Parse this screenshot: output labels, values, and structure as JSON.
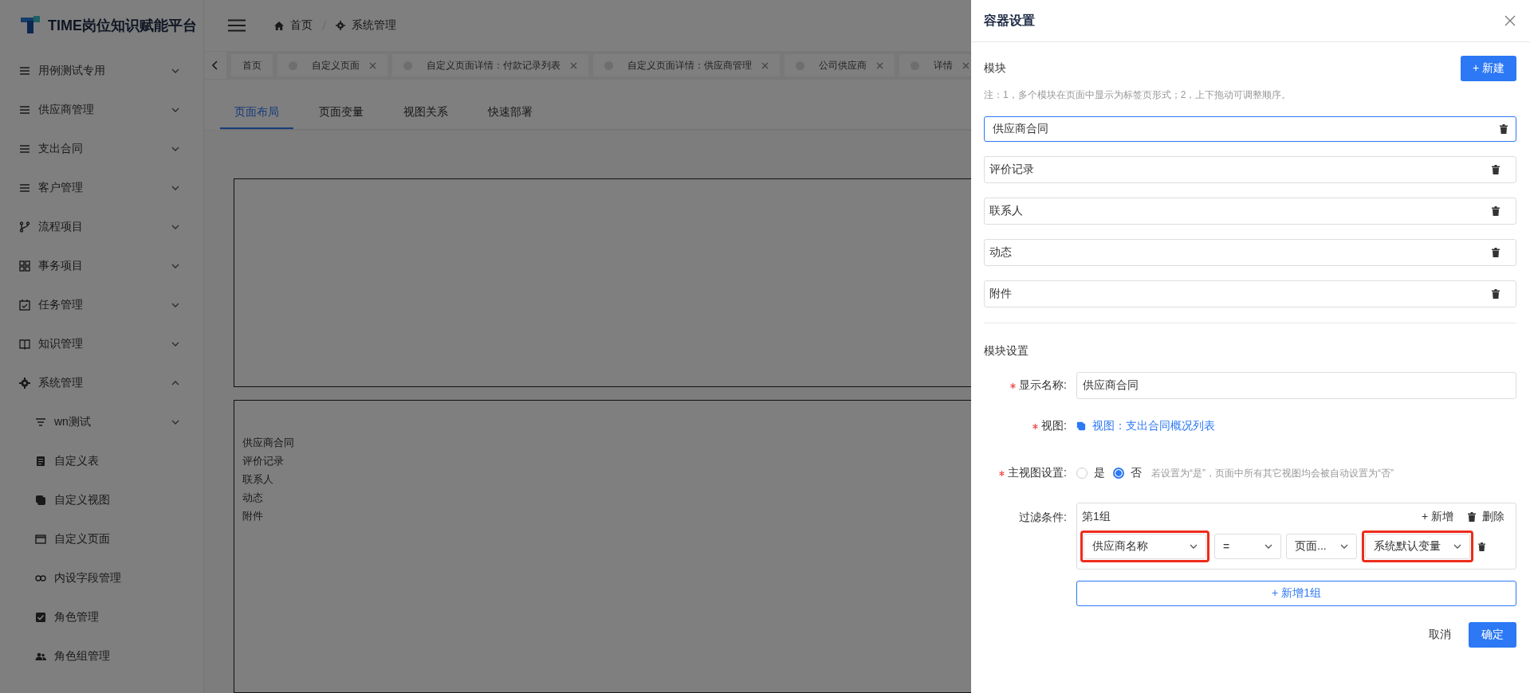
{
  "sidebar": {
    "logo": "TIME岗位知识赋能平台",
    "items": [
      {
        "label": "用例测试专用",
        "expanded": false
      },
      {
        "label": "供应商管理",
        "expanded": false
      },
      {
        "label": "支出合同",
        "expanded": false
      },
      {
        "label": "客户管理",
        "expanded": false
      },
      {
        "label": "流程项目",
        "expanded": false
      },
      {
        "label": "事务项目",
        "expanded": false
      },
      {
        "label": "任务管理",
        "expanded": false
      },
      {
        "label": "知识管理",
        "expanded": false
      },
      {
        "label": "系统管理",
        "expanded": true,
        "children": [
          {
            "label": "wn测试",
            "kind": "submenu",
            "expanded": false
          },
          {
            "label": "自定义表",
            "kind": "link"
          },
          {
            "label": "自定义视图",
            "kind": "link"
          },
          {
            "label": "自定义页面",
            "kind": "link"
          },
          {
            "label": "内设字段管理",
            "kind": "link"
          },
          {
            "label": "角色管理",
            "kind": "link"
          },
          {
            "label": "角色组管理",
            "kind": "link"
          }
        ]
      }
    ]
  },
  "breadcrumb": [
    "首页",
    "系统管理"
  ],
  "open_tabs": [
    {
      "label": "首页",
      "closable": false
    },
    {
      "label": "自定义页面",
      "closable": true
    },
    {
      "label": "自定义页面详情：付款记录列表",
      "closable": true
    },
    {
      "label": "自定义页面详情：供应商管理",
      "closable": true
    },
    {
      "label": "公司供应商",
      "closable": true
    },
    {
      "label": "详情",
      "closable": true
    }
  ],
  "page_tabs": [
    {
      "label": "页面布局",
      "selected": true
    },
    {
      "label": "页面变量",
      "selected": false
    },
    {
      "label": "视图关系",
      "selected": false
    },
    {
      "label": "快速部署",
      "selected": false
    }
  ],
  "canvas": {
    "container_items": [
      "供应商合同",
      "评价记录",
      "联系人",
      "动态",
      "附件"
    ]
  },
  "drawer": {
    "title": "容器设置",
    "modules_title": "模块",
    "new_button": "+ 新建",
    "note": "注：1，多个模块在页面中显示为标签页形式；2，上下拖动可调整顺序。",
    "modules": [
      {
        "name": "供应商合同",
        "selected": true
      },
      {
        "name": "评价记录",
        "selected": false
      },
      {
        "name": "联系人",
        "selected": false
      },
      {
        "name": "动态",
        "selected": false
      },
      {
        "name": "附件",
        "selected": false
      }
    ],
    "settings_title": "模块设置",
    "display_name": {
      "label": "显示名称:",
      "required": true,
      "value": "供应商合同"
    },
    "view": {
      "label": "视图:",
      "required": true,
      "link": "视图：支出合同概况列表"
    },
    "main_view": {
      "label": "主视图设置:",
      "required": true,
      "options": [
        {
          "label": "是",
          "selected": false
        },
        {
          "label": "否",
          "selected": true
        }
      ],
      "hint": "若设置为“是”，页面中所有其它视图均会被自动设置为“否”"
    },
    "filter": {
      "label": "过滤条件:",
      "groups": [
        {
          "title": "第1组",
          "add": "+ 新增",
          "delete": "删除",
          "selects": [
            {
              "value": "供应商名称",
              "highlighted": true
            },
            {
              "value": "=",
              "highlighted": false
            },
            {
              "value": "页面...",
              "highlighted": false
            },
            {
              "value": "系统默认变量",
              "highlighted": true
            }
          ]
        }
      ],
      "add_group": "+ 新增1组"
    },
    "cancel": "取消",
    "confirm": "确定"
  }
}
